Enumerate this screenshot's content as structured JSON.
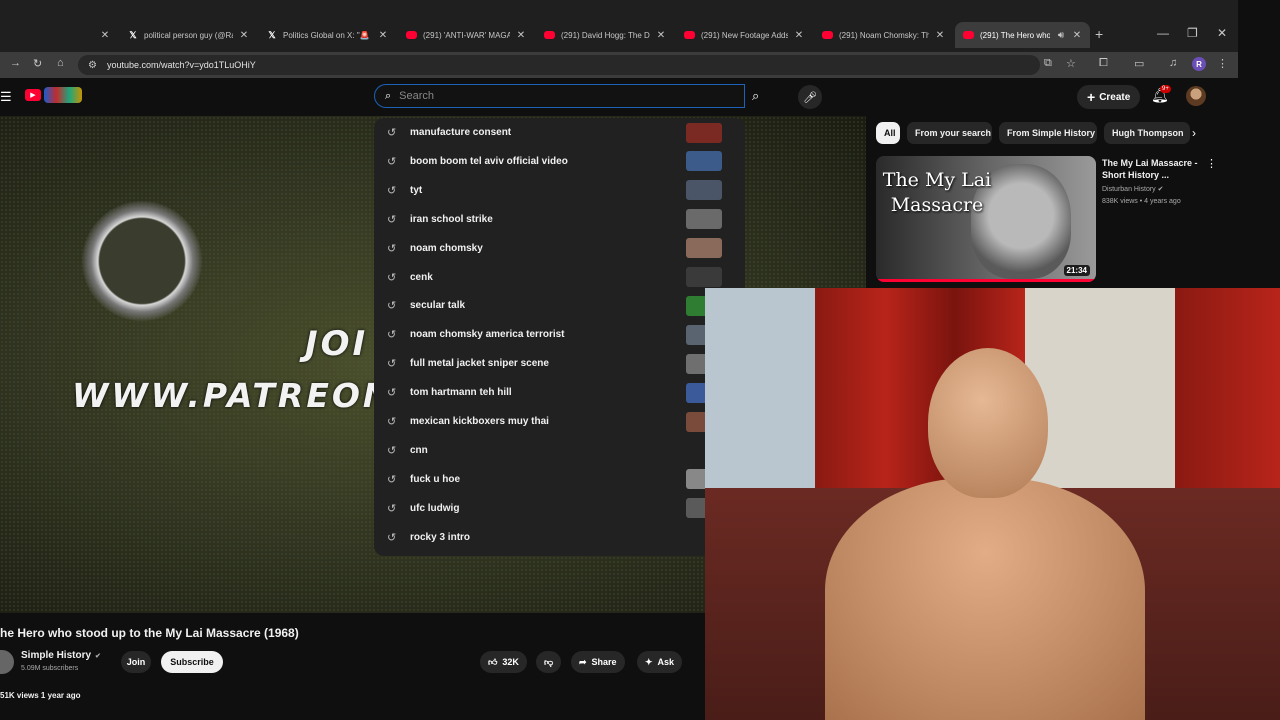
{
  "browser": {
    "tabs": [
      {
        "title": "",
        "icon": "none",
        "active": false
      },
      {
        "title": "political person guy (@Ra",
        "icon": "x",
        "active": false
      },
      {
        "title": "Politics Global on X: \"🚨",
        "icon": "x",
        "active": false
      },
      {
        "title": "(291) 'ANTI-WAR' MAGA",
        "icon": "youtube",
        "active": false
      },
      {
        "title": "(291) David Hogg: The De",
        "icon": "youtube",
        "active": false
      },
      {
        "title": "(291) New Footage Adds",
        "icon": "youtube",
        "active": false
      },
      {
        "title": "(291) Noam Chomsky: The",
        "icon": "youtube",
        "active": false
      },
      {
        "title": "(291) The Hero who st",
        "icon": "youtube",
        "active": true
      }
    ],
    "url": "youtube.com/watch?v=ydo1TLuOHiY",
    "profile_initial": "R"
  },
  "youtube": {
    "search_placeholder": "Search",
    "create_label": "Create",
    "notif_badge": "9+",
    "suggestions": [
      {
        "text": "manufacture consent",
        "thumb_color": "#7a2a22"
      },
      {
        "text": "boom boom tel aviv official video",
        "thumb_color": "#3c5a8a"
      },
      {
        "text": "tyt",
        "thumb_color": "#4a5568"
      },
      {
        "text": "iran school strike",
        "thumb_color": "#6a6a6a"
      },
      {
        "text": "noam chomsky",
        "thumb_color": "#8a6a5a"
      },
      {
        "text": "cenk",
        "thumb_color": "#3a3a3a"
      },
      {
        "text": "secular talk",
        "thumb_color": "#2e7d32"
      },
      {
        "text": "noam chomsky america terrorist",
        "thumb_color": "#5a6470"
      },
      {
        "text": "full metal jacket sniper scene",
        "thumb_color": "#6f6f6f"
      },
      {
        "text": "tom hartmann teh hill",
        "thumb_color": "#3b5a9a"
      },
      {
        "text": "mexican kickboxers muy thai",
        "thumb_color": "#7a4a3a"
      },
      {
        "text": "cnn",
        "thumb_color": ""
      },
      {
        "text": "fuck u hoe",
        "thumb_color": "#888888"
      },
      {
        "text": "ufc ludwig",
        "thumb_color": "#5a5a5a"
      },
      {
        "text": "rocky 3 intro",
        "thumb_color": ""
      }
    ],
    "video_overlay_line1": "JOI",
    "video_overlay_line2": "WWW.PATREON.C",
    "video_title": "he Hero who stood up to the My Lai Massacre (1968)",
    "channel_name": "Simple History",
    "subscriber_count": "5.09M subscribers",
    "join_label": "Join",
    "subscribe_label": "Subscribe",
    "like_count": "32K",
    "share_label": "Share",
    "ask_label": "Ask",
    "views_line": "51K views  1 year ago",
    "chips": [
      "All",
      "From your search",
      "From Simple History",
      "Hugh Thompson"
    ],
    "recommended": {
      "thumb_text": "The My Lai Massacre",
      "duration": "21:34",
      "title": "The My Lai Massacre - Short History ...",
      "channel": "Disturban History",
      "meta": "838K views • 4 years ago"
    }
  }
}
